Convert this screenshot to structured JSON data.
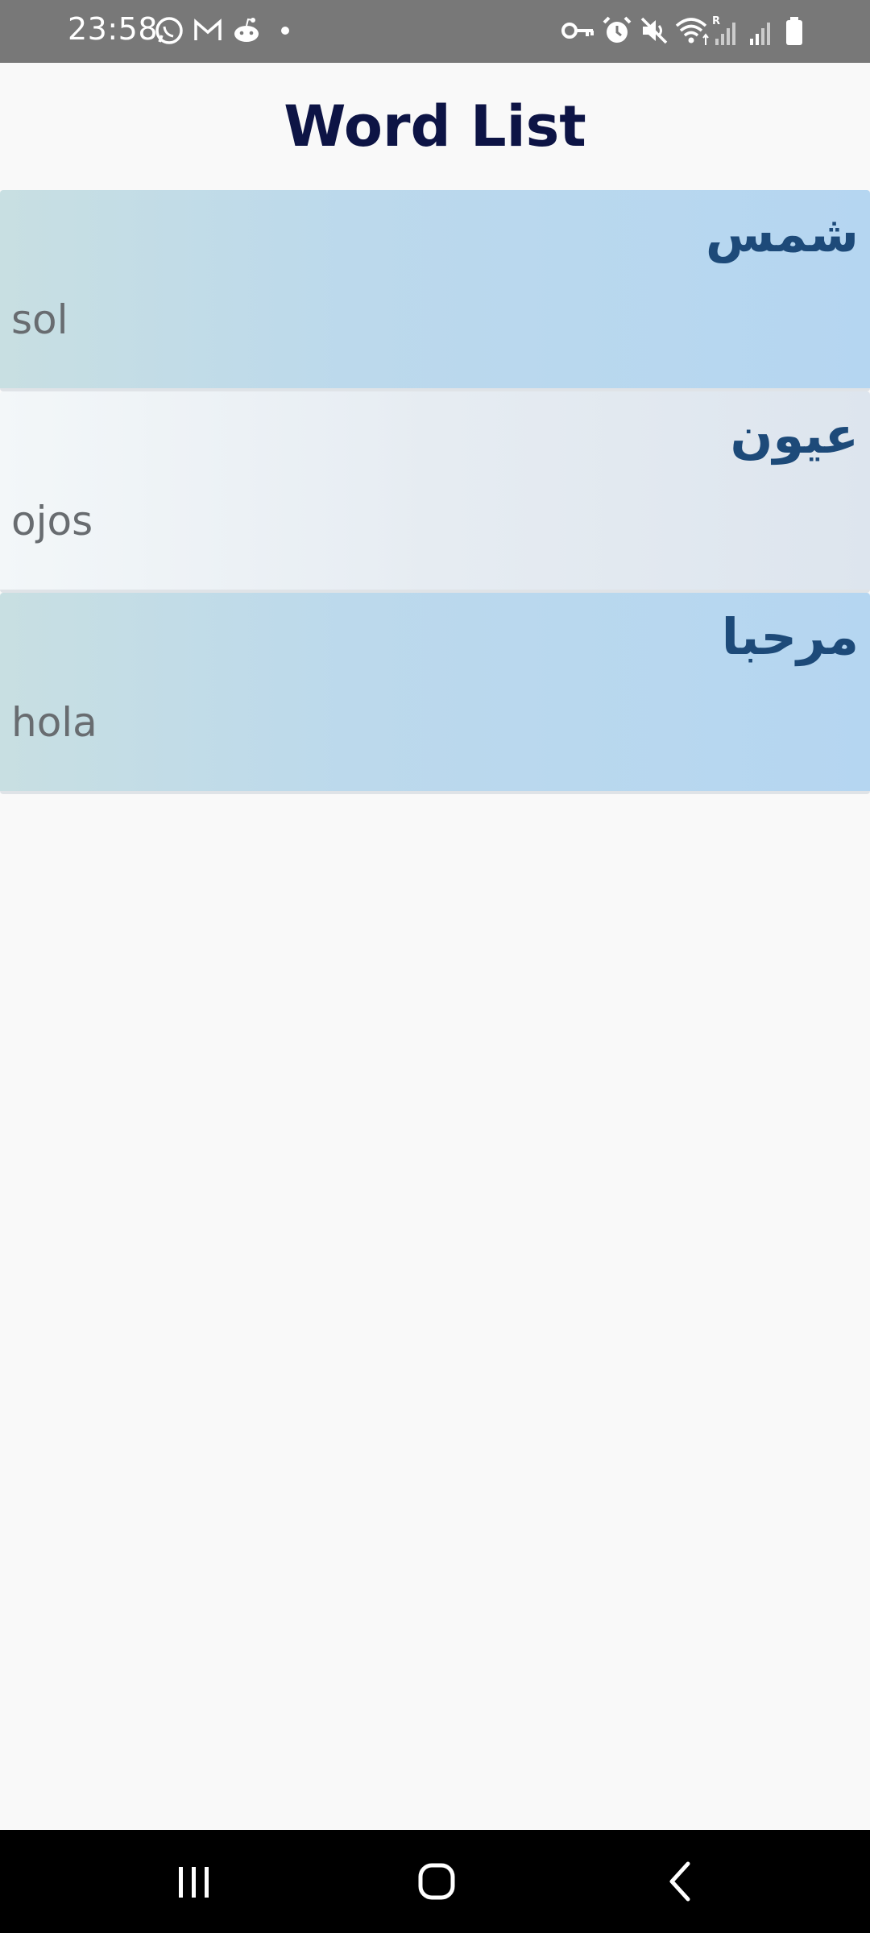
{
  "status_bar": {
    "time": "23:58",
    "left_icons": [
      "whatsapp-icon",
      "gmail-icon",
      "reddit-icon",
      "dot-icon"
    ],
    "right_icons": [
      "vpn-key-icon",
      "alarm-icon",
      "mute-icon",
      "wifi-icon",
      "signal-r-icon",
      "signal-icon",
      "battery-icon"
    ]
  },
  "header": {
    "title": "Word List"
  },
  "words": [
    {
      "arabic": "شمس",
      "translation": "sol"
    },
    {
      "arabic": "عيون",
      "translation": "ojos"
    },
    {
      "arabic": "مرحبا",
      "translation": "hola"
    }
  ],
  "nav_bar": {
    "buttons": [
      "recent-apps",
      "home",
      "back"
    ]
  },
  "colors": {
    "status_bar": "#787878",
    "title": "#0d1445",
    "arabic_text": "#1d4a79",
    "translation_text": "#686c70",
    "item_blue": "#b5d6f1",
    "item_light": "#e6ecf2"
  }
}
